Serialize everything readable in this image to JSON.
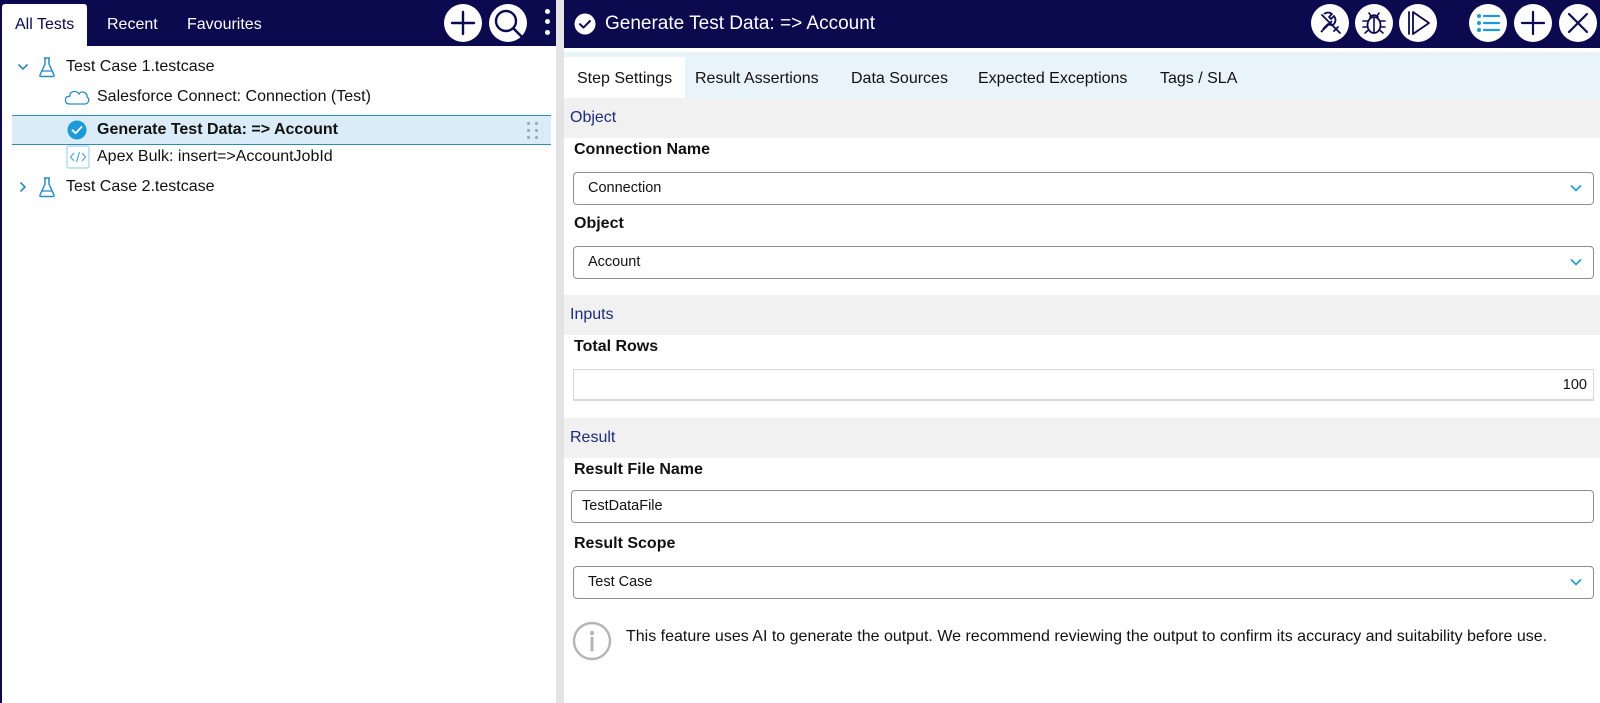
{
  "left_panel": {
    "tabs": [
      "All Tests",
      "Recent",
      "Favourites"
    ],
    "tree": {
      "case1": "Test Case 1.testcase",
      "step1": "Salesforce Connect: Connection (Test)",
      "step2": "Generate Test Data: => Account",
      "step3": "Apex Bulk: insert=>AccountJobId",
      "case2": "Test Case 2.testcase"
    }
  },
  "right_panel": {
    "title": "Generate Test Data: => Account",
    "tabs": [
      "Step Settings",
      "Result Assertions",
      "Data Sources",
      "Expected Exceptions",
      "Tags / SLA"
    ],
    "sections": {
      "object": "Object",
      "inputs": "Inputs",
      "result": "Result"
    },
    "fields": {
      "connection_name_label": "Connection Name",
      "connection_name_value": "Connection",
      "object_label": "Object",
      "object_value": "Account",
      "total_rows_label": "Total Rows",
      "total_rows_value": "100",
      "result_file_label": "Result File Name",
      "result_file_value": "TestDataFile",
      "result_scope_label": "Result Scope",
      "result_scope_value": "Test Case"
    },
    "notice": "This feature uses AI to generate the output. We recommend reviewing the output to confirm its accuracy and suitability before use."
  },
  "colors": {
    "navy": "#0b0a4f",
    "selected_row_bg": "#d9ecf7",
    "selected_row_border": "#2b8cc4",
    "tab_strip_bg": "#e8f4fa",
    "section_bg": "#f1f1f1",
    "section_text": "#1b2d7a",
    "accent_blue": "#1e9ad6"
  },
  "icons": {
    "left_toolbar": [
      "plus-icon",
      "search-icon",
      "kebab-menu-icon"
    ],
    "right_toolbar": [
      "tools-icon",
      "bug-icon",
      "run-icon",
      "list-icon",
      "plus-icon",
      "close-icon"
    ]
  }
}
